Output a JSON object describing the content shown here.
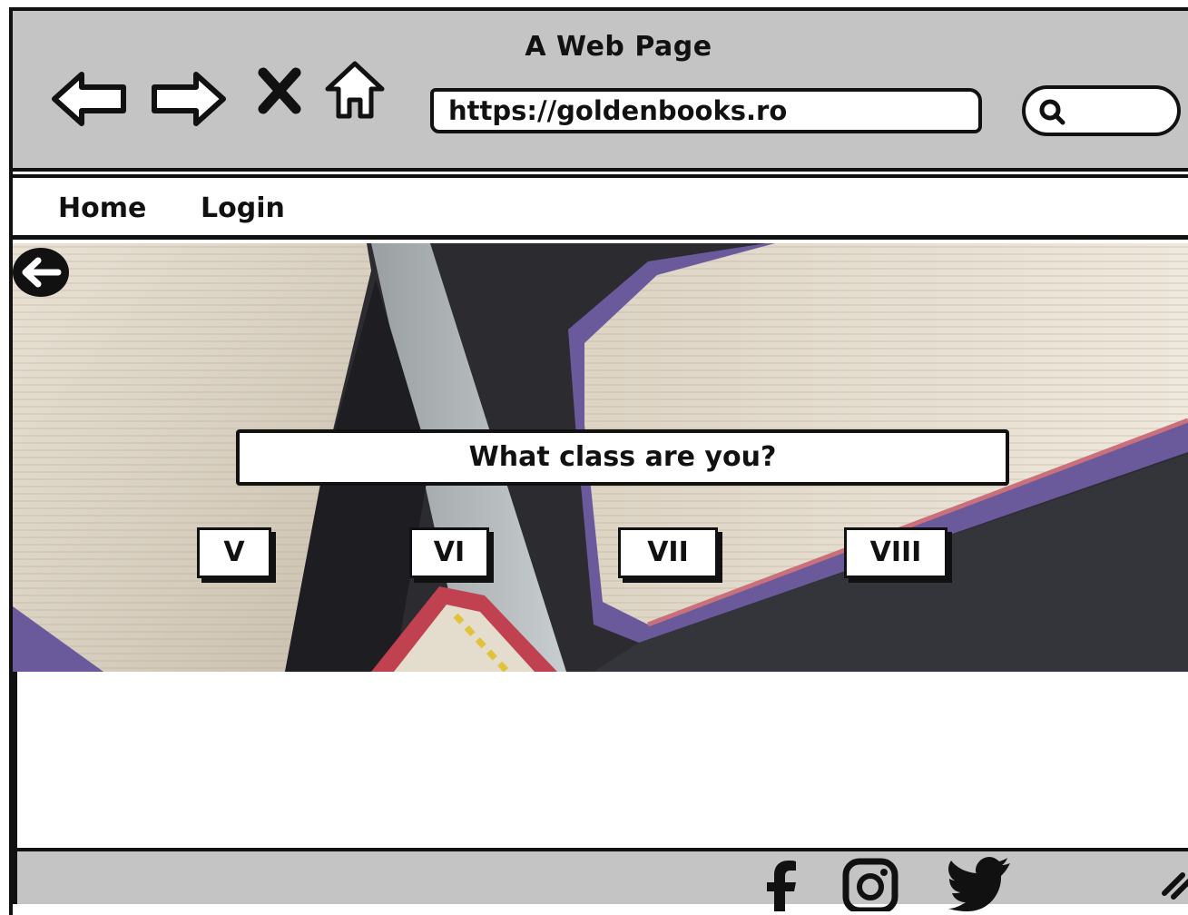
{
  "window": {
    "title": "A Web Page"
  },
  "browser": {
    "url": "https://goldenbooks.ro",
    "search_value": "",
    "icons": [
      "back-arrow-icon",
      "forward-arrow-icon",
      "close-icon",
      "home-icon",
      "search-icon"
    ]
  },
  "menu": {
    "items": [
      {
        "label": "Home"
      },
      {
        "label": "Login"
      }
    ]
  },
  "hero": {
    "question": "What class are you?",
    "classes": [
      {
        "label": "V"
      },
      {
        "label": "VI"
      },
      {
        "label": "VII"
      },
      {
        "label": "VIII"
      }
    ]
  },
  "footer": {
    "icons": [
      "facebook-icon",
      "instagram-icon",
      "twitter-icon",
      "resize-handle-icon"
    ]
  },
  "colors": {
    "chrome": "#c4c4c4",
    "ink": "#111111",
    "book_cover": "#6a5a9c",
    "book_cover_red": "#c0414f"
  }
}
